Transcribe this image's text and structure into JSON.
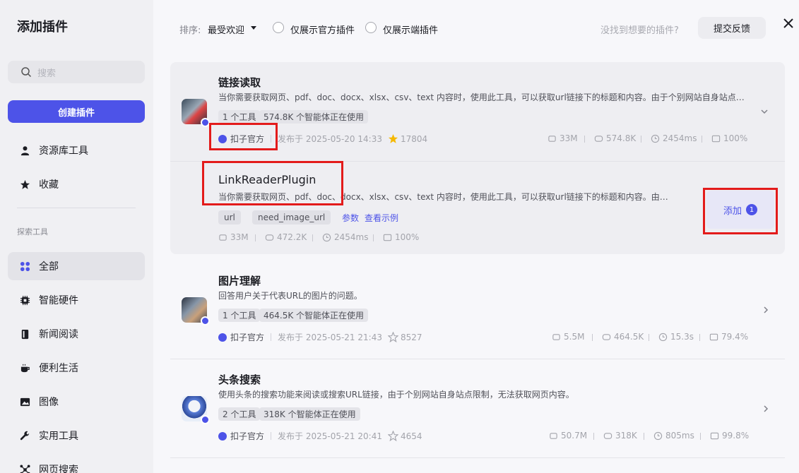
{
  "sidebar": {
    "title": "添加插件",
    "search_placeholder": "搜索",
    "create_button": "创建插件",
    "items_top": [
      {
        "label": "资源库工具",
        "icon": "person-icon"
      },
      {
        "label": "收藏",
        "icon": "star-icon"
      }
    ],
    "section_title": "探索工具",
    "categories": [
      {
        "label": "全部",
        "icon": "grid-icon",
        "active": true
      },
      {
        "label": "智能硬件",
        "icon": "chip-icon"
      },
      {
        "label": "新闻阅读",
        "icon": "book-icon"
      },
      {
        "label": "便利生活",
        "icon": "cup-icon"
      },
      {
        "label": "图像",
        "icon": "image-icon"
      },
      {
        "label": "实用工具",
        "icon": "wrench-icon"
      },
      {
        "label": "网页搜索",
        "icon": "network-icon"
      }
    ]
  },
  "topbar": {
    "sort_label": "排序:",
    "sort_value": "最受欢迎",
    "filter_official": "仅展示官方插件",
    "filter_device": "仅展示端插件",
    "hint": "没找到想要的插件?",
    "feedback_button": "提交反馈"
  },
  "plugins": [
    {
      "title": "链接读取",
      "desc": "当你需要获取网页、pdf、doc、docx、xlsx、csv、text 内容时，使用此工具，可以获取url链接下的标题和内容。由于个别网站自身站点…",
      "tags": [
        "1 个工具",
        "574.8K 个智能体正在使用"
      ],
      "publisher": "扣子官方",
      "published": "发布于 2025-05-20 14:33",
      "stars": "17804",
      "stats": [
        "33M",
        "574.8K",
        "2454ms",
        "100%"
      ],
      "expanded": true,
      "tools": [
        {
          "name": "LinkReaderPlugin",
          "desc": "当你需要获取网页、pdf、doc、docx、xlsx、csv、text 内容时，使用此工具，可以获取url链接下的标题和内容。由于…",
          "params": [
            "url",
            "need_image_url"
          ],
          "links": [
            "参数",
            "查看示例"
          ],
          "stats": [
            "33M",
            "472.2K",
            "2454ms",
            "100%"
          ],
          "add_label": "添加",
          "add_count": "1"
        }
      ]
    },
    {
      "title": "图片理解",
      "desc": "回答用户关于代表URL的图片的问题。",
      "tags": [
        "1 个工具",
        "464.5K 个智能体正在使用"
      ],
      "publisher": "扣子官方",
      "published": "发布于 2025-05-21 21:43",
      "stars": "8527",
      "stats": [
        "5.5M",
        "464.5K",
        "15.3s",
        "79.4%"
      ]
    },
    {
      "title": "头条搜索",
      "desc": "使用头条的搜索功能来阅读或搜索URL链接，由于个别网站自身站点限制，无法获取网页内容。",
      "tags": [
        "2 个工具",
        "318K 个智能体正在使用"
      ],
      "publisher": "扣子官方",
      "published": "发布于 2025-05-21 20:41",
      "stars": "4654",
      "stats": [
        "50.7M",
        "318K",
        "805ms",
        "99.8%"
      ]
    }
  ],
  "colors": {
    "accent": "#4d53e8",
    "highlight": "#e31b1b"
  }
}
